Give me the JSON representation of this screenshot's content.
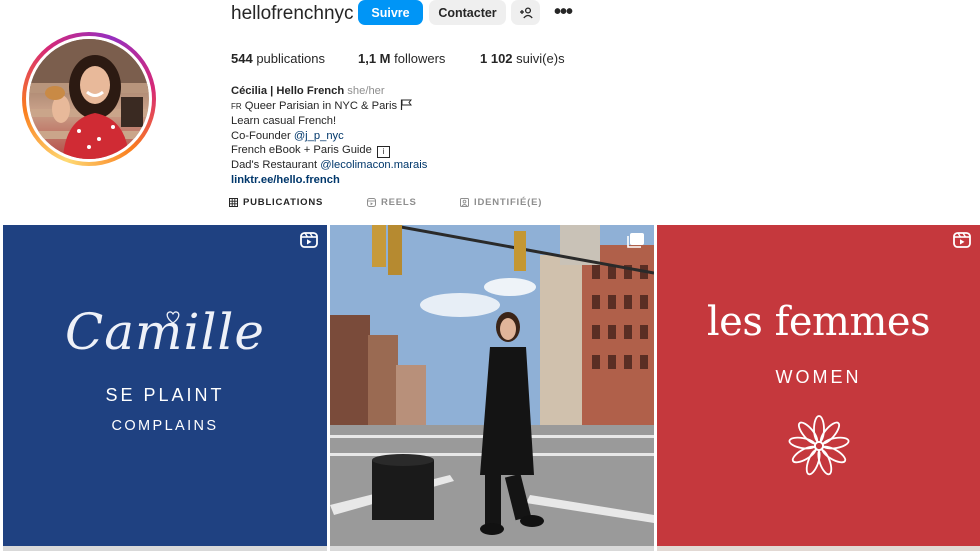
{
  "profile": {
    "username": "hellofrenchnyc",
    "follow_label": "Suivre",
    "contact_label": "Contacter",
    "more_label": "•••"
  },
  "stats": {
    "posts_count": "544",
    "posts_label": "publications",
    "followers_count": "1,1 M",
    "followers_label": "followers",
    "following_count": "1 102",
    "following_label": "suivi(e)s"
  },
  "bio": {
    "name": "Cécilia | Hello French",
    "pronouns": "she/her",
    "line1_prefix": "FR",
    "line1": "Queer Parisian in NYC & Paris",
    "line2": "Learn casual French!",
    "line3_prefix": "Co-Founder",
    "line3_mention": "@j_p_nyc",
    "line4": "French eBook + Paris Guide",
    "line4_icon": "i",
    "line5_prefix": "Dad's Restaurant",
    "line5_mention": "@lecolimacon.marais",
    "link": "linktr.ee/hello.french"
  },
  "tabs": [
    {
      "label": "PUBLICATIONS",
      "icon": "grid-icon",
      "active": true
    },
    {
      "label": "REELS",
      "icon": "reels-icon",
      "active": false
    },
    {
      "label": "IDENTIFIÉ(E)",
      "icon": "tagged-icon",
      "active": false
    }
  ],
  "posts": [
    {
      "title": "Camille",
      "line1": "SE PLAINT",
      "line2": "COMPLAINS",
      "type": "reel",
      "bg": "#1f4181"
    },
    {
      "type": "photo",
      "bg": "#9fb7cf"
    },
    {
      "title": "les femmes",
      "line1": "WOMEN",
      "type": "reel",
      "bg": "#c5383d"
    }
  ],
  "colors": {
    "accent_blue": "#0095f6",
    "link_blue": "#00376b",
    "secondary_text": "#8e8e8e"
  }
}
